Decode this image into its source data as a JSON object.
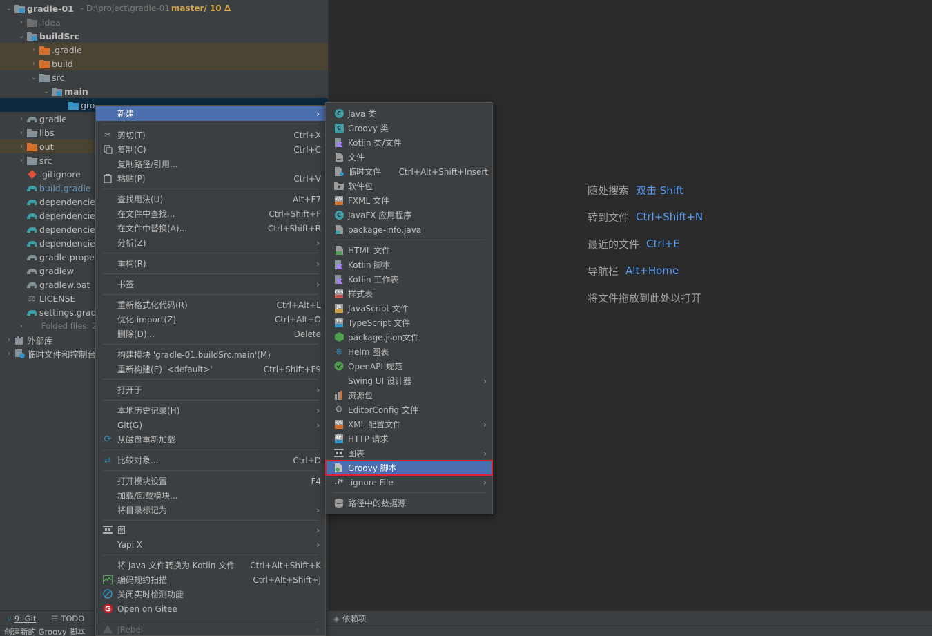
{
  "project": {
    "root_name": "gradle-01",
    "root_path": "- D:\\project\\gradle-01",
    "branch": "master/ 10 Δ",
    "items": [
      {
        "label": ".idea"
      },
      {
        "label": "buildSrc"
      },
      {
        "label": ".gradle"
      },
      {
        "label": "build"
      },
      {
        "label": "src"
      },
      {
        "label": "main"
      },
      {
        "label": "gro"
      },
      {
        "label": "gradle"
      },
      {
        "label": "libs"
      },
      {
        "label": "out"
      },
      {
        "label": "src"
      },
      {
        "label": ".gitignore"
      },
      {
        "label": "build.gradle"
      },
      {
        "label": "dependencie"
      },
      {
        "label": "dependencie"
      },
      {
        "label": "dependencie"
      },
      {
        "label": "dependencie"
      },
      {
        "label": "gradle.prope"
      },
      {
        "label": "gradlew"
      },
      {
        "label": "gradlew.bat"
      },
      {
        "label": "LICENSE"
      },
      {
        "label": "settings.grad"
      },
      {
        "label": "Folded files: 2"
      },
      {
        "label": "外部库"
      },
      {
        "label": "临时文件和控制台"
      }
    ]
  },
  "context_menu": [
    {
      "label": "新建",
      "shortcut": ""
    },
    {
      "label": "剪切(T)",
      "shortcut": "Ctrl+X"
    },
    {
      "label": "复制(C)",
      "shortcut": "Ctrl+C"
    },
    {
      "label": "复制路径/引用...",
      "shortcut": ""
    },
    {
      "label": "粘贴(P)",
      "shortcut": "Ctrl+V"
    },
    {
      "label": "查找用法(U)",
      "shortcut": "Alt+F7"
    },
    {
      "label": "在文件中查找...",
      "shortcut": "Ctrl+Shift+F"
    },
    {
      "label": "在文件中替换(A)...",
      "shortcut": "Ctrl+Shift+R"
    },
    {
      "label": "分析(Z)",
      "shortcut": ""
    },
    {
      "label": "重构(R)",
      "shortcut": ""
    },
    {
      "label": "书签",
      "shortcut": ""
    },
    {
      "label": "重新格式化代码(R)",
      "shortcut": "Ctrl+Alt+L"
    },
    {
      "label": "优化 import(Z)",
      "shortcut": "Ctrl+Alt+O"
    },
    {
      "label": "删除(D)...",
      "shortcut": "Delete"
    },
    {
      "label": "构建模块 'gradle-01.buildSrc.main'(M)",
      "shortcut": ""
    },
    {
      "label": "重新构建(E) '<default>'",
      "shortcut": "Ctrl+Shift+F9"
    },
    {
      "label": "打开于",
      "shortcut": ""
    },
    {
      "label": "本地历史记录(H)",
      "shortcut": ""
    },
    {
      "label": "Git(G)",
      "shortcut": ""
    },
    {
      "label": "从磁盘重新加载",
      "shortcut": ""
    },
    {
      "label": "比较对象...",
      "shortcut": "Ctrl+D"
    },
    {
      "label": "打开模块设置",
      "shortcut": "F4"
    },
    {
      "label": "加载/卸载模块...",
      "shortcut": ""
    },
    {
      "label": "将目录标记为",
      "shortcut": ""
    },
    {
      "label": "图",
      "shortcut": ""
    },
    {
      "label": "Yapi X",
      "shortcut": ""
    },
    {
      "label": "将 Java 文件转换为 Kotlin 文件",
      "shortcut": "Ctrl+Alt+Shift+K"
    },
    {
      "label": "编码规约扫描",
      "shortcut": "Ctrl+Alt+Shift+J"
    },
    {
      "label": "关闭实时检测功能",
      "shortcut": ""
    },
    {
      "label": "Open on Gitee",
      "shortcut": ""
    },
    {
      "label": "JRebel",
      "shortcut": ""
    }
  ],
  "new_submenu": [
    {
      "label": "Java 类",
      "shortcut": ""
    },
    {
      "label": "Groovy 类",
      "shortcut": ""
    },
    {
      "label": "Kotlin 类/文件",
      "shortcut": ""
    },
    {
      "label": "文件",
      "shortcut": ""
    },
    {
      "label": "临时文件",
      "shortcut": "Ctrl+Alt+Shift+Insert"
    },
    {
      "label": "软件包",
      "shortcut": ""
    },
    {
      "label": "FXML 文件",
      "shortcut": ""
    },
    {
      "label": "JavaFX 应用程序",
      "shortcut": ""
    },
    {
      "label": "package-info.java",
      "shortcut": ""
    },
    {
      "label": "HTML 文件",
      "shortcut": ""
    },
    {
      "label": "Kotlin 脚本",
      "shortcut": ""
    },
    {
      "label": "Kotlin 工作表",
      "shortcut": ""
    },
    {
      "label": "样式表",
      "shortcut": ""
    },
    {
      "label": "JavaScript 文件",
      "shortcut": ""
    },
    {
      "label": "TypeScript 文件",
      "shortcut": ""
    },
    {
      "label": "package.json文件",
      "shortcut": ""
    },
    {
      "label": "Helm 图表",
      "shortcut": ""
    },
    {
      "label": "OpenAPI 规范",
      "shortcut": ""
    },
    {
      "label": "Swing UI 设计器",
      "shortcut": ""
    },
    {
      "label": "资源包",
      "shortcut": ""
    },
    {
      "label": "EditorConfig 文件",
      "shortcut": ""
    },
    {
      "label": "XML 配置文件",
      "shortcut": ""
    },
    {
      "label": "HTTP 请求",
      "shortcut": ""
    },
    {
      "label": "图表",
      "shortcut": ""
    },
    {
      "label": "Groovy 脚本",
      "shortcut": ""
    },
    {
      "label": ".ignore File",
      "shortcut": ""
    },
    {
      "label": "路径中的数据源",
      "shortcut": ""
    }
  ],
  "editor_hints": [
    {
      "label": "随处搜索",
      "shortcut": "双击 Shift"
    },
    {
      "label": "转到文件",
      "shortcut": "Ctrl+Shift+N"
    },
    {
      "label": "最近的文件",
      "shortcut": "Ctrl+E"
    },
    {
      "label": "导航栏",
      "shortcut": "Alt+Home"
    },
    {
      "label": "将文件拖放到此处以打开",
      "shortcut": ""
    }
  ],
  "tool_tabs": {
    "git": "9: Git",
    "todo": "TODO",
    "deps": "依赖项"
  },
  "status": {
    "text": "创建新的 Groovy 脚本"
  },
  "colors": {
    "selection": "#4b6eaf",
    "highlight_box": "#e0222e",
    "shortcut_link": "#589df6",
    "excluded_bg": "#4b4433",
    "branch": "#d0a248"
  }
}
